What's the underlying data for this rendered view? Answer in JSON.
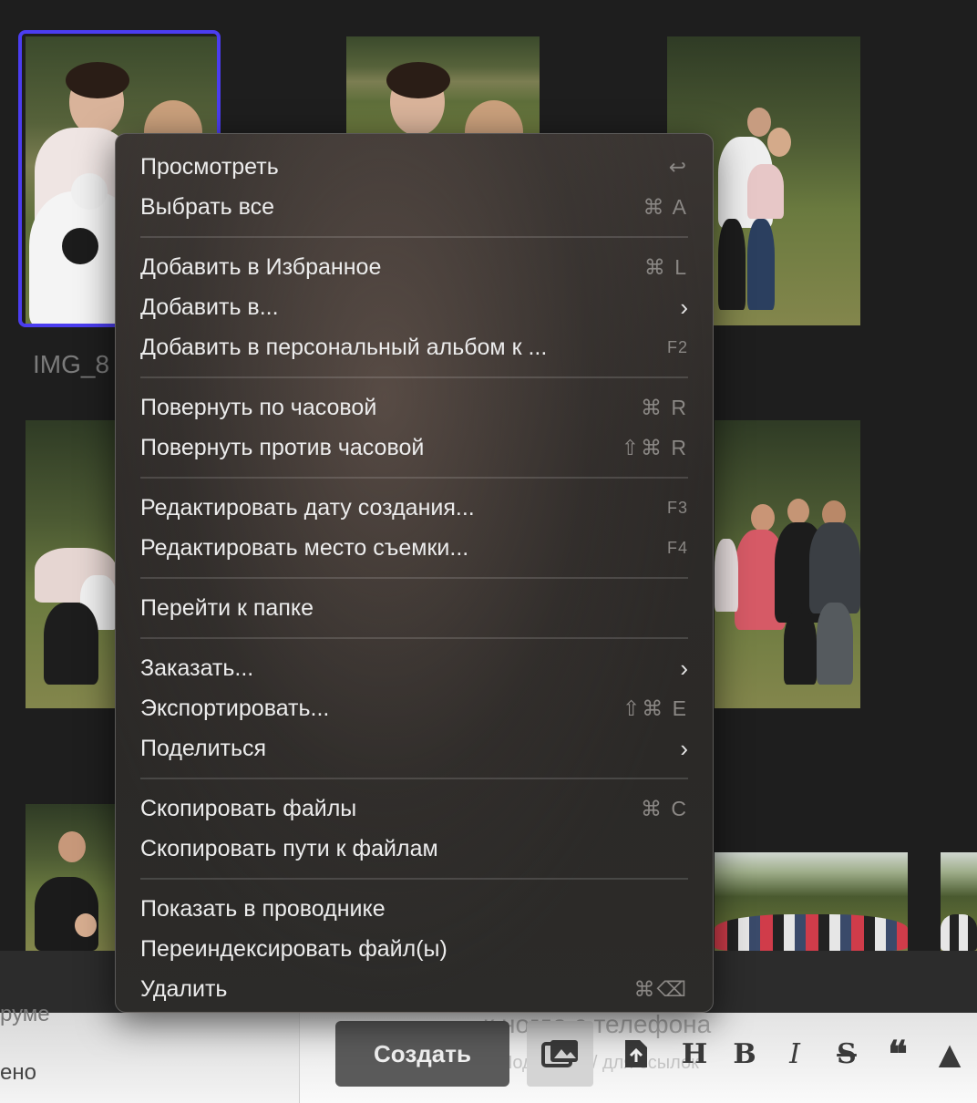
{
  "grid": {
    "selected_file_label": "IMG_8"
  },
  "menu": {
    "groups": [
      [
        {
          "label": "Просмотреть",
          "shortcut": "↩"
        },
        {
          "label": "Выбрать все",
          "shortcut": "⌘ A"
        }
      ],
      [
        {
          "label": "Добавить в Избранное",
          "shortcut": "⌘ L"
        },
        {
          "label": "Добавить в...",
          "submenu": true
        },
        {
          "label": "Добавить в персональный альбом к ...",
          "shortcut": "F2"
        }
      ],
      [
        {
          "label": "Повернуть по часовой",
          "shortcut": "⌘ R"
        },
        {
          "label": "Повернуть против часовой",
          "shortcut": "⇧⌘ R"
        }
      ],
      [
        {
          "label": "Редактировать дату создания...",
          "shortcut": "F3"
        },
        {
          "label": "Редактировать место съемки...",
          "shortcut": "F4"
        }
      ],
      [
        {
          "label": "Перейти к папке"
        }
      ],
      [
        {
          "label": "Заказать...",
          "submenu": true
        },
        {
          "label": "Экспортировать...",
          "shortcut": "⇧⌘ E"
        },
        {
          "label": "Поделиться",
          "submenu": true
        }
      ],
      [
        {
          "label": "Скопировать файлы",
          "shortcut": "⌘ C"
        },
        {
          "label": "Скопировать пути к файлам"
        }
      ],
      [
        {
          "label": "Показать в проводнике"
        },
        {
          "label": "Переиндексировать файл(ы)"
        },
        {
          "label": "Удалить",
          "shortcut": "⌘⌫"
        }
      ]
    ]
  },
  "editor": {
    "left_text_top": "руме",
    "left_text_bottom": "ено",
    "ghost_title": "к   ногда с телефона",
    "ghost_sub": "Подсказка / для ссылок",
    "create_button": "Создать",
    "tools": [
      "H",
      "B",
      "I",
      "S",
      "❝",
      "▲"
    ]
  },
  "colors": {
    "selection": "#4b3df0",
    "menu_bg": "#2d2a28",
    "background": "#1e1e1e"
  }
}
